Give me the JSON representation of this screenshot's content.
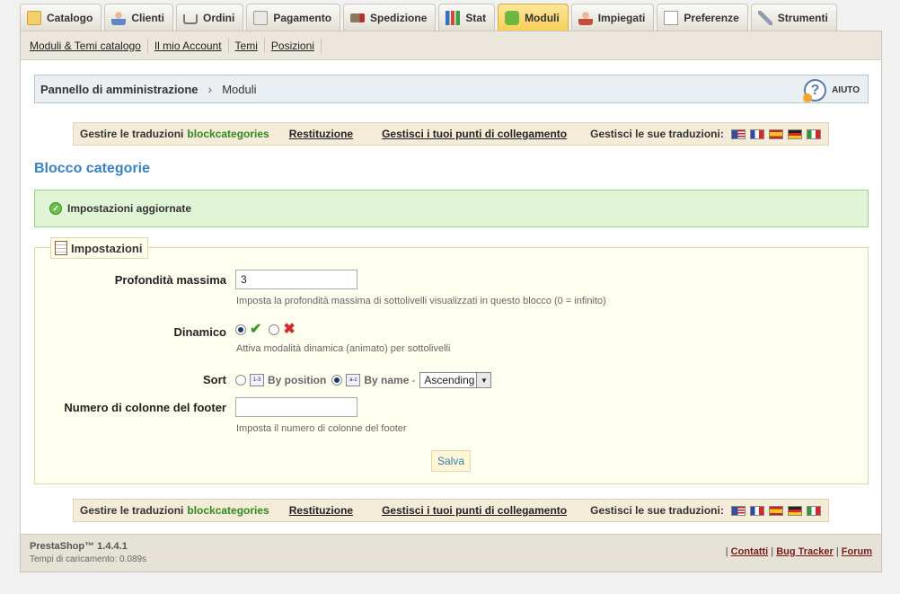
{
  "tabs": [
    {
      "label": "Catalogo",
      "icon": "folder-icon"
    },
    {
      "label": "Clienti",
      "icon": "customers-icon"
    },
    {
      "label": "Ordini",
      "icon": "cart-icon"
    },
    {
      "label": "Pagamento",
      "icon": "payment-icon"
    },
    {
      "label": "Spedizione",
      "icon": "truck-icon"
    },
    {
      "label": "Stat",
      "icon": "stats-icon"
    },
    {
      "label": "Moduli",
      "icon": "puzzle-icon",
      "active": true
    },
    {
      "label": "Impiegati",
      "icon": "employee-icon"
    },
    {
      "label": "Preferenze",
      "icon": "preferences-icon"
    },
    {
      "label": "Strumenti",
      "icon": "wrench-icon"
    }
  ],
  "subtabs": [
    "Moduli & Temi catalogo",
    "Il mio Account",
    "Temi",
    "Posizioni"
  ],
  "breadcrumb": {
    "root": "Pannello di amministrazione",
    "separator": "›",
    "current": "Moduli"
  },
  "help": {
    "label": "AIUTO",
    "glyph": "?"
  },
  "translations": {
    "manage_prefix": "Gestire le traduzioni",
    "module": "blockcategories",
    "restore": "Restituzione",
    "hooks": "Gestisci i tuoi punti di collegamento",
    "manage_own": "Gestisci le sue traduzioni:",
    "flags": [
      "us",
      "fr",
      "es",
      "de",
      "it"
    ]
  },
  "module_title": "Blocco categorie",
  "success": {
    "icon": "check-circle-icon",
    "glyph": "✓",
    "message": "Impostazioni aggiornate"
  },
  "settings": {
    "legend": "Impostazioni",
    "max_depth": {
      "label": "Profondità massima",
      "value": "3",
      "help": "Imposta la profondità massima di sottolivelli visualizzati in questo blocco (0 = infinito)"
    },
    "dynamic": {
      "label": "Dinamico",
      "selected": "yes",
      "yes_glyph": "✔",
      "no_glyph": "✖",
      "help": "Attiva modalità dinamica (animato) per sottolivelli"
    },
    "sort": {
      "label": "Sort",
      "by_position": "By position",
      "by_name": "By name",
      "selected": "name",
      "dash": "-",
      "direction": "Ascending",
      "pos_glyph": "1-3",
      "name_glyph": "a-z",
      "arrow": "▼"
    },
    "footer_columns": {
      "label": "Numero di colonne del footer",
      "value": "",
      "help": "Imposta il numero di colonne del footer"
    },
    "save": "Salva"
  },
  "footer": {
    "version": "PrestaShop™ 1.4.4.1",
    "load_time": "Tempi di caricamento: 0.089s",
    "sep": "|",
    "links": [
      "Contatti",
      "Bug Tracker",
      "Forum"
    ]
  }
}
